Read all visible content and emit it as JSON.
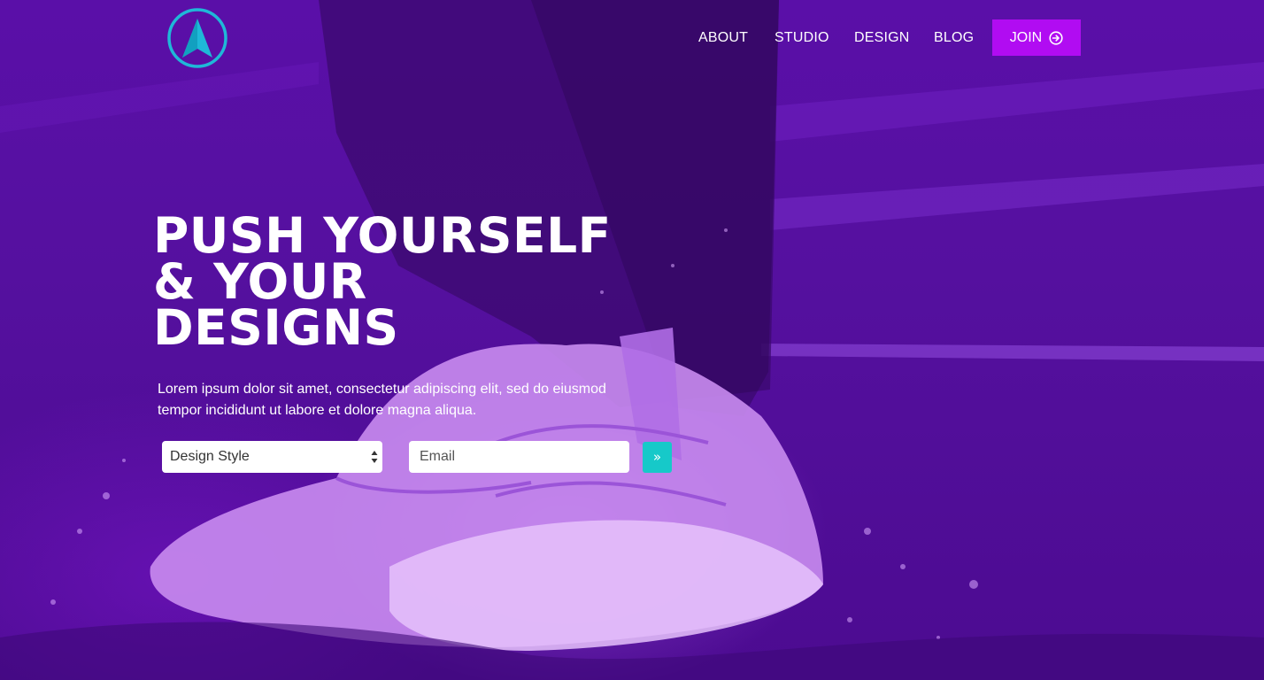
{
  "nav": {
    "links": [
      "ABOUT",
      "STUDIO",
      "DESIGN",
      "BLOG"
    ],
    "join_label": "JOIN",
    "join_icon": "arrow-circle-right-icon"
  },
  "hero": {
    "headline": [
      "PUSH YOURSELF",
      "& YOUR",
      "DESIGNS"
    ],
    "lead": "Lorem ipsum dolor sit amet, consectetur adipiscing elit, sed do eiusmod tempor incididunt ut labore et dolore magna aliqua."
  },
  "form": {
    "select_value": "Design Style",
    "email_placeholder": "Email",
    "submit_glyph": "»"
  },
  "colors": {
    "background": "#4a0a8c",
    "join_button": "#b10cf2",
    "submit_button": "#16c9c9",
    "logo": "#1fb8d8"
  }
}
